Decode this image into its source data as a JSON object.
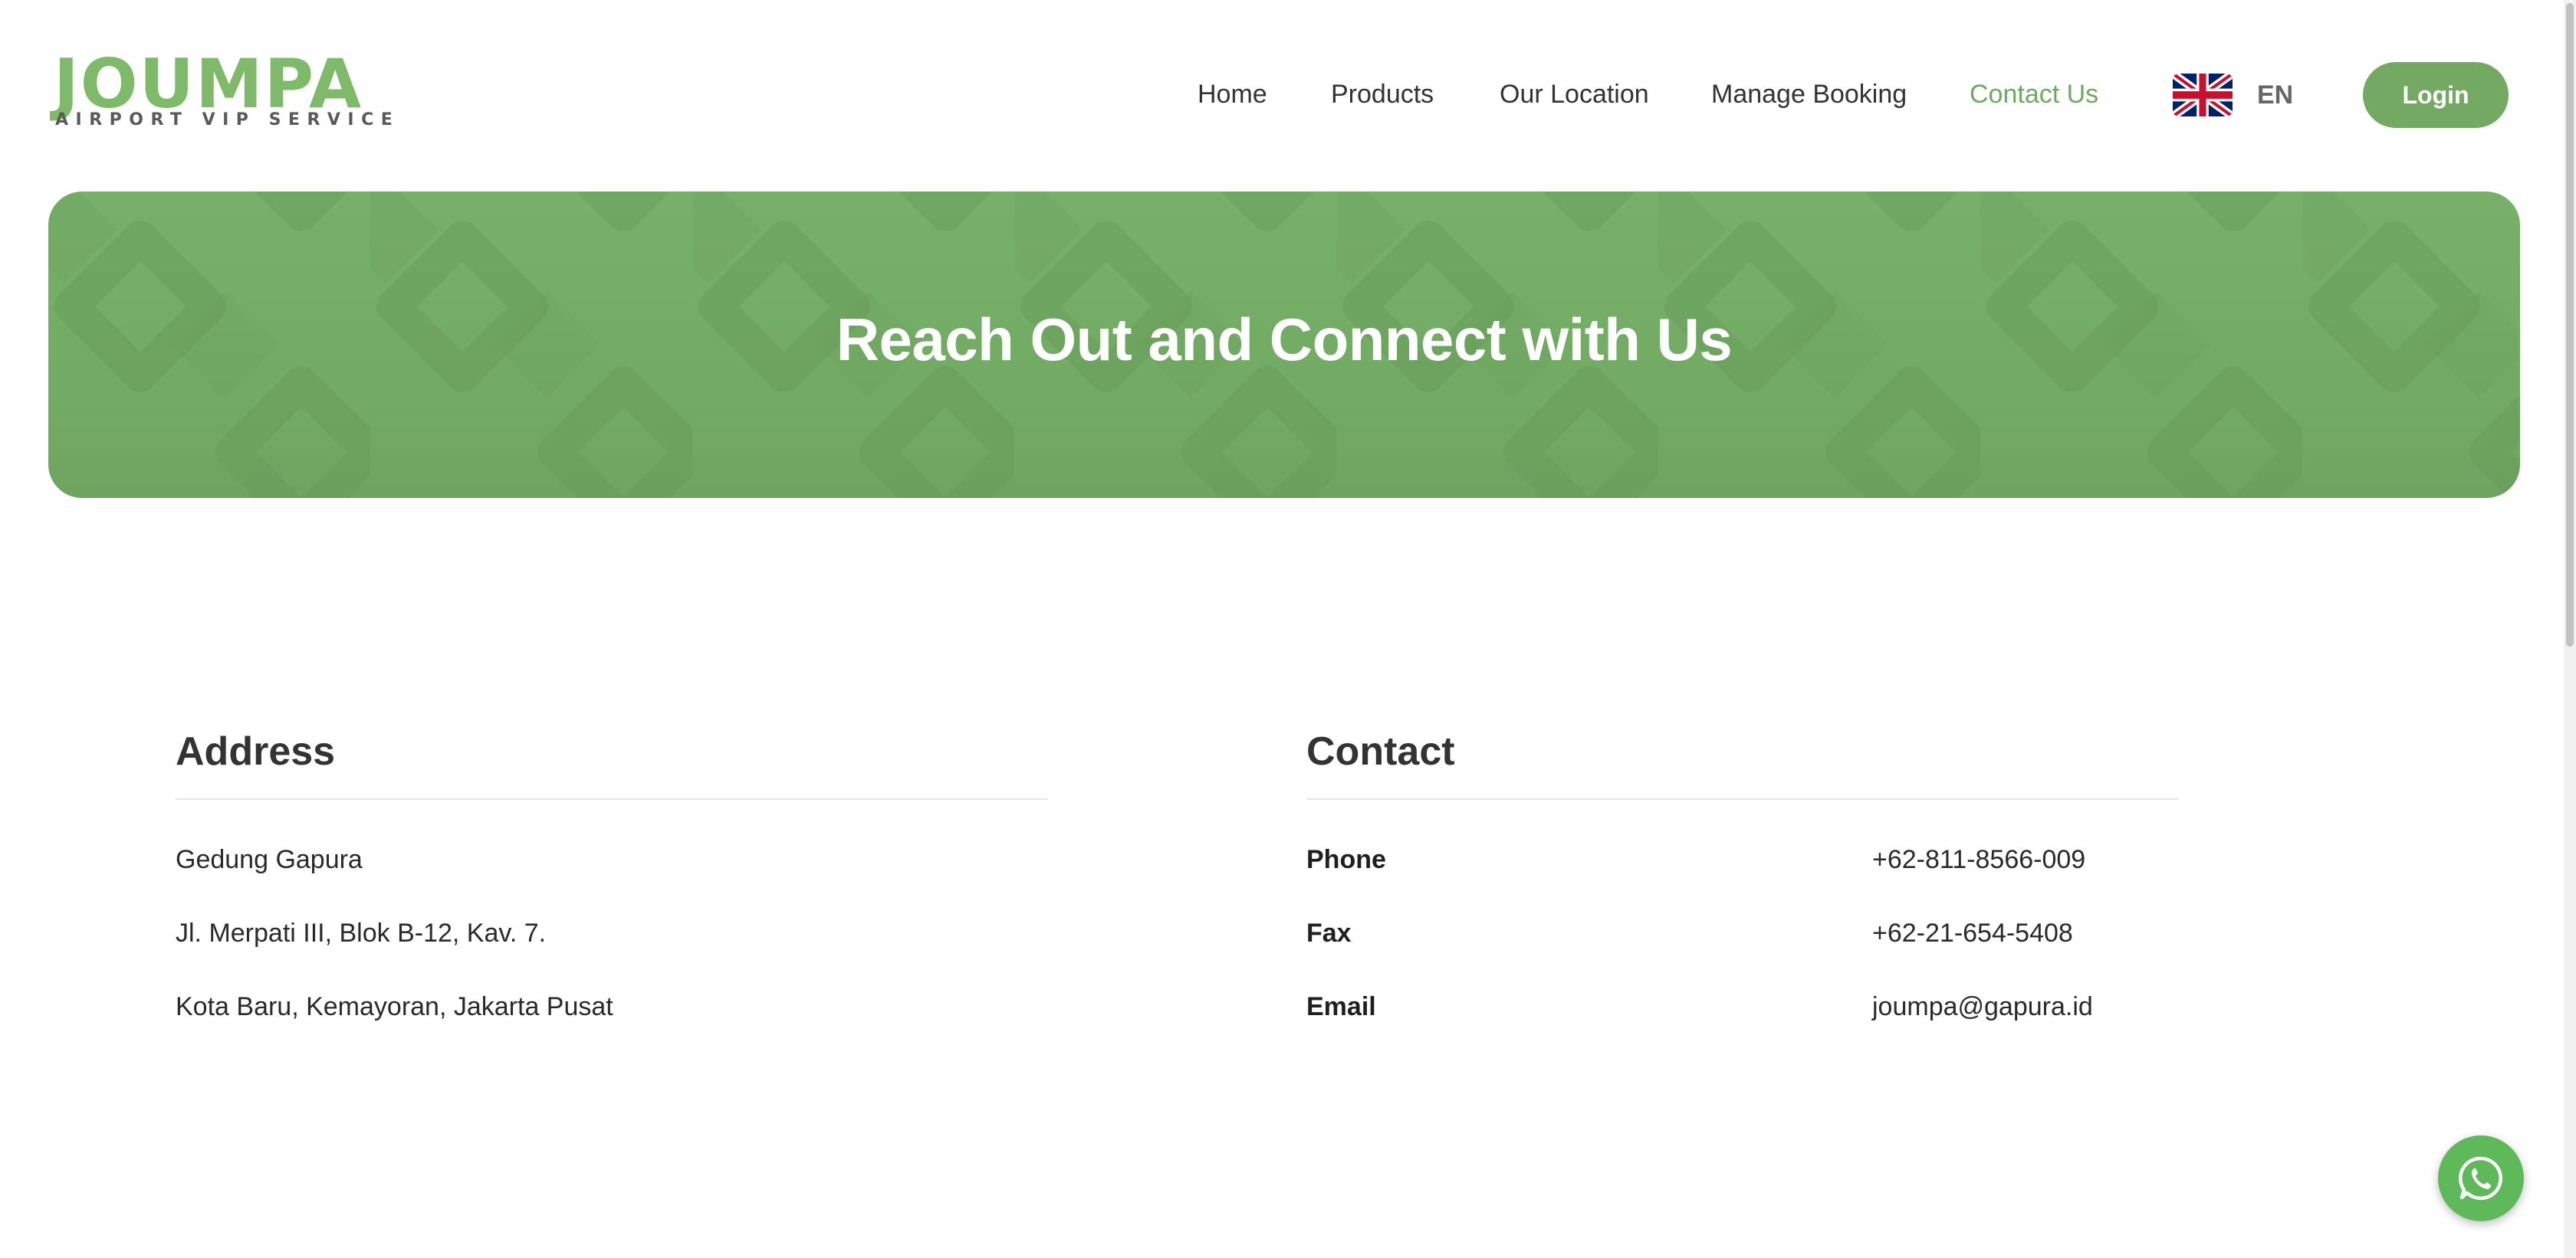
{
  "brand": {
    "logo_word": "JOUMPA",
    "logo_tagline": "AIRPORT VIP SERVICE"
  },
  "nav": {
    "items": [
      {
        "label": "Home"
      },
      {
        "label": "Products"
      },
      {
        "label": "Our Location"
      },
      {
        "label": "Manage Booking"
      },
      {
        "label": "Contact Us",
        "active": true
      }
    ]
  },
  "language": {
    "code": "EN",
    "flag_icon": "uk-flag-icon"
  },
  "login": {
    "label": "Login"
  },
  "hero": {
    "title": "Reach Out and Connect with Us"
  },
  "address": {
    "title": "Address",
    "lines": [
      "Gedung Gapura",
      "Jl. Merpati III, Blok B-12, Kav. 7.",
      "Kota Baru, Kemayoran, Jakarta Pusat"
    ]
  },
  "contact": {
    "title": "Contact",
    "rows": [
      {
        "label": "Phone",
        "value": "+62-811-8566-009"
      },
      {
        "label": "Fax",
        "value": "+62-21-654-5408"
      },
      {
        "label": "Email",
        "value": "joumpa@gapura.id"
      }
    ]
  },
  "whatsapp": {
    "icon": "whatsapp-icon"
  },
  "colors": {
    "brand_green": "#73a963",
    "active_nav": "#6fa85f",
    "hero_green": "#76ae67",
    "whatsapp_green": "#5fb85a"
  }
}
